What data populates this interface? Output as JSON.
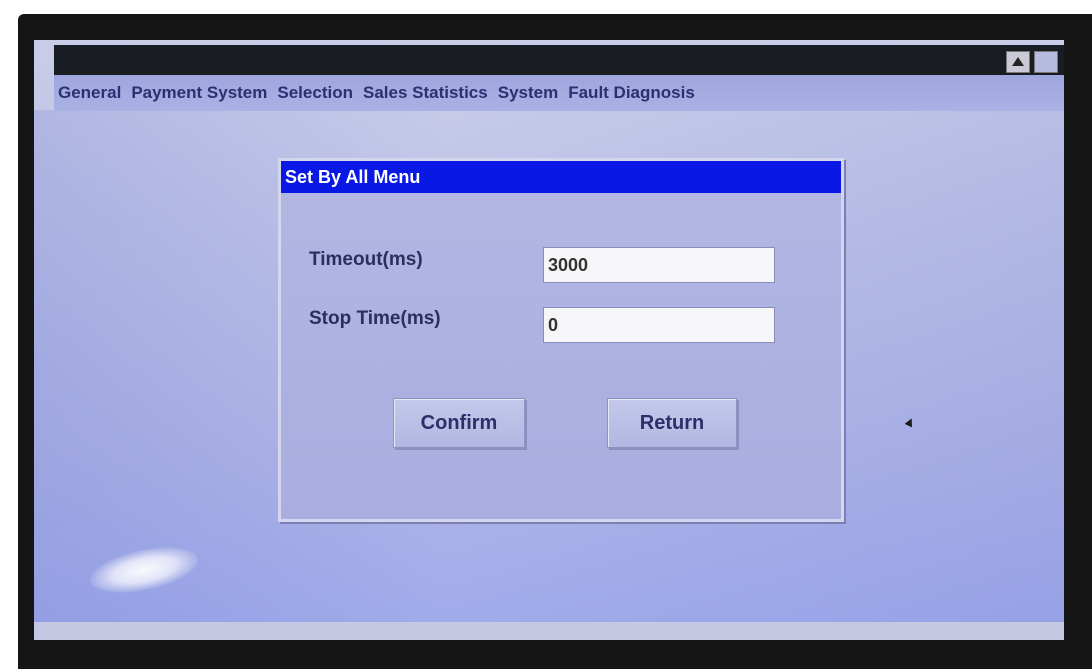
{
  "window": {
    "scroll_up_icon": "triangle-up-icon",
    "square_icon": "square-icon"
  },
  "menubar": {
    "items": [
      {
        "label": "General"
      },
      {
        "label": "Payment System"
      },
      {
        "label": "Selection"
      },
      {
        "label": "Sales Statistics"
      },
      {
        "label": "System"
      },
      {
        "label": "Fault Diagnosis"
      }
    ]
  },
  "dialog": {
    "title": "Set By All Menu",
    "timeout_label": "Timeout(ms)",
    "timeout_value": "3000",
    "stop_time_label": "Stop Time(ms)",
    "stop_time_value": "0",
    "confirm_label": "Confirm",
    "return_label": "Return"
  },
  "colors": {
    "dialog_title_bar": "#0a18e6",
    "screen_background": "#b9bee6",
    "menu_text": "#2b3170"
  }
}
